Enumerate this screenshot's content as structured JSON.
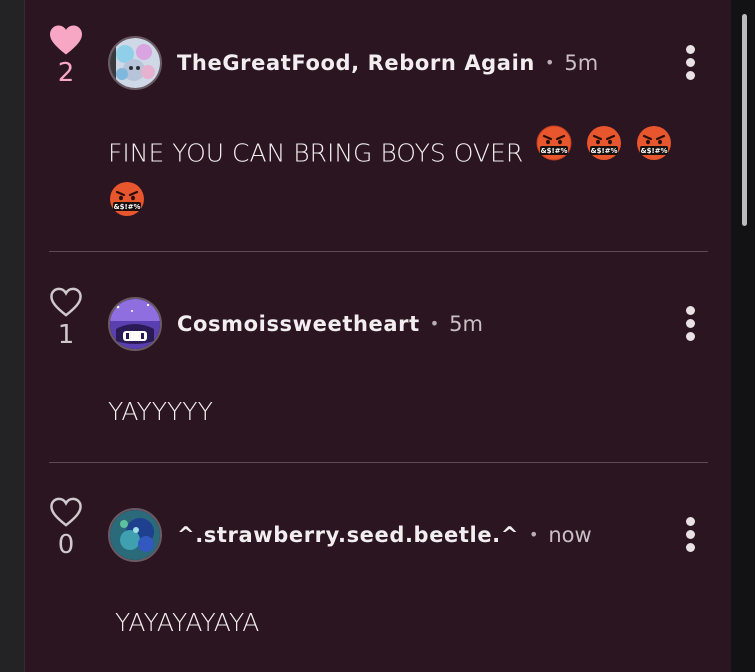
{
  "comments": [
    {
      "liked": true,
      "like_count": "2",
      "username": "TheGreatFood, Reborn Again",
      "separator": "•",
      "time": "5m",
      "text": "FINE YOU CAN BRING BOYS OVER",
      "emoji_caption": "&$!#%"
    },
    {
      "liked": false,
      "like_count": "1",
      "username": "Cosmoissweetheart",
      "separator": "•",
      "time": "5m",
      "text": "YAYYYYY"
    },
    {
      "liked": false,
      "like_count": "0",
      "username": "^.strawberry.seed.beetle.^",
      "separator": "•",
      "time": "now",
      "text": "YAYAYAYAYA"
    }
  ],
  "icons": {
    "like_filled": "heart-filled-icon",
    "like_outline": "heart-outline-icon",
    "more": "more-vertical-icon",
    "emoji": "face-with-symbols-on-mouth-emoji"
  },
  "colors": {
    "panel_bg": "#2b1520",
    "liked_pink": "#f7a6c4",
    "unliked_gray": "#cfc8cc",
    "text": "#f3eff1",
    "divider": "#5b4a53"
  }
}
